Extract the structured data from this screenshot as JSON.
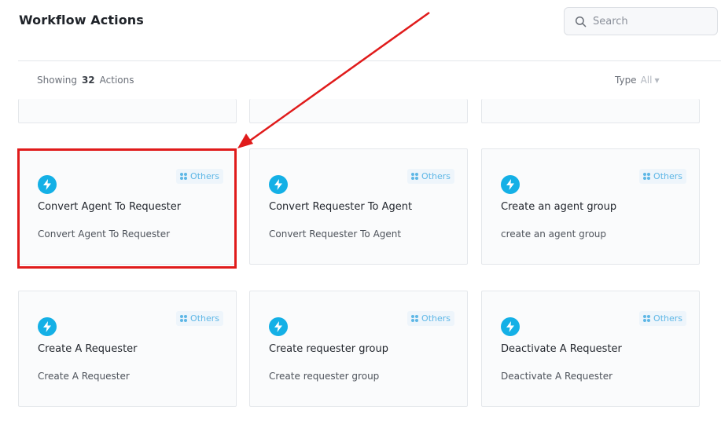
{
  "header": {
    "title": "Workflow Actions"
  },
  "search": {
    "placeholder": "Search"
  },
  "toolbar": {
    "showing_prefix": "Showing",
    "count": "32",
    "showing_suffix": "Actions",
    "type_label": "Type",
    "type_value": "All"
  },
  "cards": [
    {
      "title": "Convert Agent To Requester",
      "description": "Convert Agent To Requester",
      "category": "Others",
      "icon": "bolt-icon"
    },
    {
      "title": "Convert Requester To Agent",
      "description": "Convert Requester To Agent",
      "category": "Others",
      "icon": "bolt-icon"
    },
    {
      "title": "Create an agent group",
      "description": "create an agent group",
      "category": "Others",
      "icon": "bolt-icon"
    },
    {
      "title": "Create A Requester",
      "description": "Create A Requester",
      "category": "Others",
      "icon": "bolt-icon"
    },
    {
      "title": "Create requester group",
      "description": "Create requester group",
      "category": "Others",
      "icon": "bolt-icon"
    },
    {
      "title": "Deactivate A Requester",
      "description": "Deactivate A Requester",
      "category": "Others",
      "icon": "bolt-icon"
    }
  ],
  "colors": {
    "accent": "#14b0e6",
    "badge_text": "#5eb7e6",
    "highlight": "#e01b1b"
  }
}
